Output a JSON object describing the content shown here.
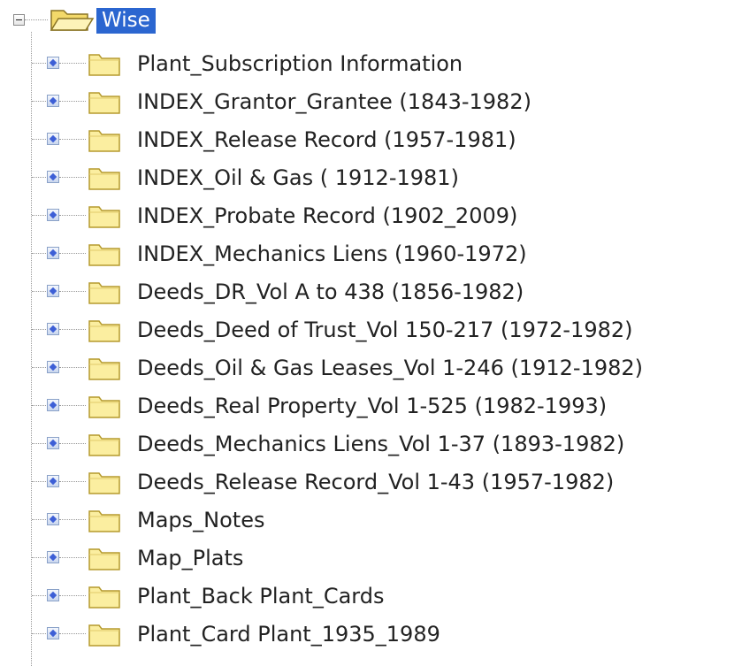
{
  "tree": {
    "root": {
      "label": "Wise",
      "expanded": true,
      "selected": true,
      "icon": "open-folder-icon"
    },
    "children": [
      {
        "label": "Plant_Subscription Information",
        "icon": "folder-icon"
      },
      {
        "label": "INDEX_Grantor_Grantee (1843-1982)",
        "icon": "folder-icon"
      },
      {
        "label": "INDEX_Release Record (1957-1981)",
        "icon": "folder-icon"
      },
      {
        "label": "INDEX_Oil & Gas ( 1912-1981)",
        "icon": "folder-icon"
      },
      {
        "label": "INDEX_Probate Record (1902_2009)",
        "icon": "folder-icon"
      },
      {
        "label": "INDEX_Mechanics Liens (1960-1972)",
        "icon": "folder-icon"
      },
      {
        "label": "Deeds_DR_Vol A to 438 (1856-1982)",
        "icon": "folder-icon"
      },
      {
        "label": "Deeds_Deed of Trust_Vol 150-217 (1972-1982)",
        "icon": "folder-icon"
      },
      {
        "label": "Deeds_Oil & Gas Leases_Vol 1-246 (1912-1982)",
        "icon": "folder-icon"
      },
      {
        "label": "Deeds_Real Property_Vol 1-525 (1982-1993)",
        "icon": "folder-icon"
      },
      {
        "label": "Deeds_Mechanics Liens_Vol 1-37 (1893-1982)",
        "icon": "folder-icon"
      },
      {
        "label": "Deeds_Release Record_Vol 1-43 (1957-1982)",
        "icon": "folder-icon"
      },
      {
        "label": "Maps_Notes",
        "icon": "folder-icon"
      },
      {
        "label": "Map_Plats",
        "icon": "folder-icon"
      },
      {
        "label": "Plant_Back Plant_Cards",
        "icon": "folder-icon"
      },
      {
        "label": "Plant_Card Plant_1935_1989",
        "icon": "folder-icon"
      }
    ]
  },
  "colors": {
    "selection": "#2b66d0",
    "folder_fill": "#fbeea0",
    "folder_border": "#b59a2e",
    "expander_diamond": "#3d5fd6"
  }
}
